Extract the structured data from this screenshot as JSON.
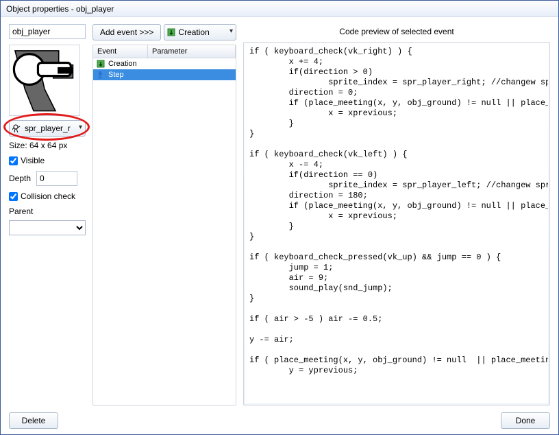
{
  "window": {
    "title": "Object properties - obj_player"
  },
  "object": {
    "name": "obj_player",
    "sprite": "spr_player_r",
    "size_text": "Size: 64 x 64 px",
    "visible_label": "Visible",
    "visible": true,
    "depth_label": "Depth",
    "depth": "0",
    "collision_label": "Collision check",
    "collision": true,
    "parent_label": "Parent",
    "parent": ""
  },
  "toolbar": {
    "add_event_label": "Add event >>>",
    "event_type_label": "Creation"
  },
  "event_columns": [
    "Event",
    "Parameter"
  ],
  "events": [
    {
      "name": "Creation",
      "selected": false
    },
    {
      "name": "Step",
      "selected": true
    }
  ],
  "code_title": "Code preview of selected event",
  "code": "if ( keyboard_check(vk_right) ) {\n        x += 4;\n        if(direction > 0)\n                sprite_index = spr_player_right; //changew sprite\n        direction = 0;\n        if (place_meeting(x, y, obj_ground) != null || place_mee\n                x = xprevious;\n        }\n}\n\nif ( keyboard_check(vk_left) ) {\n        x -= 4;\n        if(direction == 0)\n                sprite_index = spr_player_left; //changew sprite\n        direction = 180;\n        if (place_meeting(x, y, obj_ground) != null || place_mee\n                x = xprevious;\n        }\n}\n\nif ( keyboard_check_pressed(vk_up) && jump == 0 ) {\n        jump = 1;\n        air = 9;\n        sound_play(snd_jump);\n}\n\nif ( air > -5 ) air -= 0.5;\n\ny -= air;\n\nif ( place_meeting(x, y, obj_ground) != null  || place_meeting(\n        y = yprevious;\n",
  "buttons": {
    "delete": "Delete",
    "done": "Done"
  }
}
